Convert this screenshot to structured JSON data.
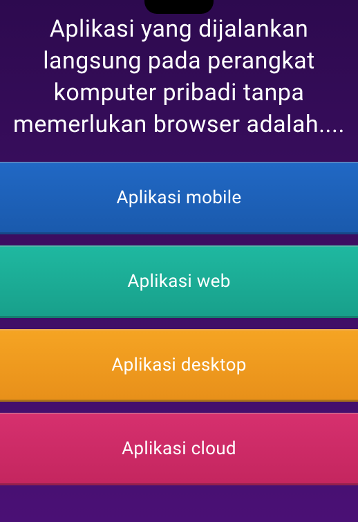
{
  "question": {
    "text": "Aplikasi yang dijalankan langsung pada perangkat komputer pribadi tanpa memerlukan browser adalah...."
  },
  "answers": [
    {
      "label": "Aplikasi mobile"
    },
    {
      "label": "Aplikasi web"
    },
    {
      "label": "Aplikasi desktop"
    },
    {
      "label": "Aplikasi cloud"
    }
  ]
}
